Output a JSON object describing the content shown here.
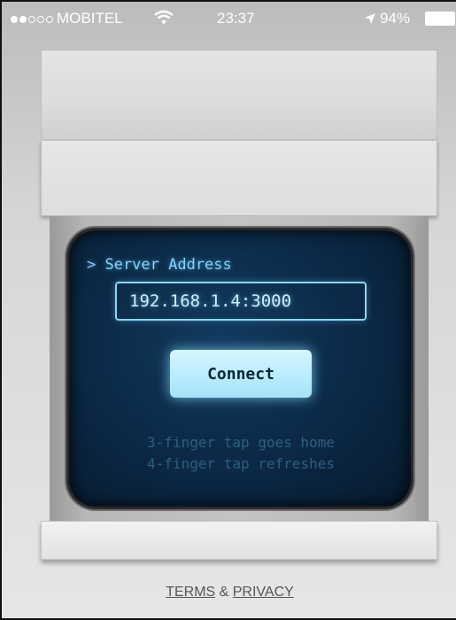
{
  "status_bar": {
    "carrier": "MOBITEL",
    "time": "23:37",
    "battery": "94%"
  },
  "terminal": {
    "prompt_label": "> Server Address",
    "server_address_value": "192.168.1.4:3000",
    "connect_label": "Connect",
    "hint_line_1": "3-finger tap goes home",
    "hint_line_2": "4-finger tap refreshes",
    "accent_color": "#7fd6ff",
    "screen_color": "#0b2845"
  },
  "footer": {
    "terms_label": "TERMS",
    "separator": " & ",
    "privacy_label": "PRIVACY"
  }
}
